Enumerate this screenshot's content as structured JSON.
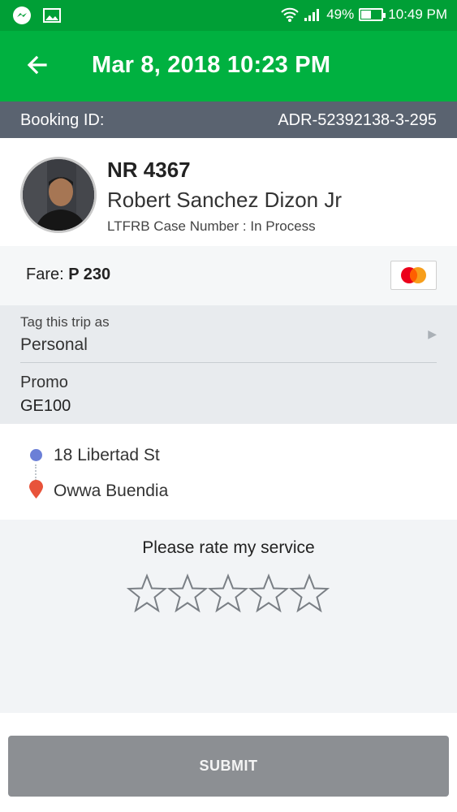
{
  "status_bar": {
    "battery_percent_text": "49%",
    "battery_level": 0.49,
    "time": "10:49 PM",
    "icons": [
      "messenger-icon",
      "image-icon",
      "wifi-icon",
      "signal-icon",
      "battery-icon"
    ]
  },
  "app_bar": {
    "title": "Mar 8, 2018 10:23 PM",
    "back_icon": "arrow-left-icon",
    "color": "#00b140"
  },
  "booking": {
    "label": "Booking ID:",
    "value": "ADR-52392138-3-295"
  },
  "driver": {
    "plate": "NR 4367",
    "name": "Robert Sanchez Dizon Jr",
    "ltfrb": "LTFRB Case Number : In Process"
  },
  "fare": {
    "label": "Fare: ",
    "amount": "P 230",
    "payment_icon": "mastercard-icon"
  },
  "trip_tag": {
    "label": "Tag this trip as",
    "value": "Personal"
  },
  "promo": {
    "label": "Promo",
    "code": "GE100"
  },
  "route": {
    "pickup": "18 Libertad St",
    "dropoff": "Owwa Buendia",
    "pickup_color": "#6b7fd7",
    "dropoff_color": "#e8533a"
  },
  "rating": {
    "prompt": "Please rate my service",
    "max_stars": 5,
    "selected": 0
  },
  "submit": {
    "label": "SUBMIT"
  }
}
